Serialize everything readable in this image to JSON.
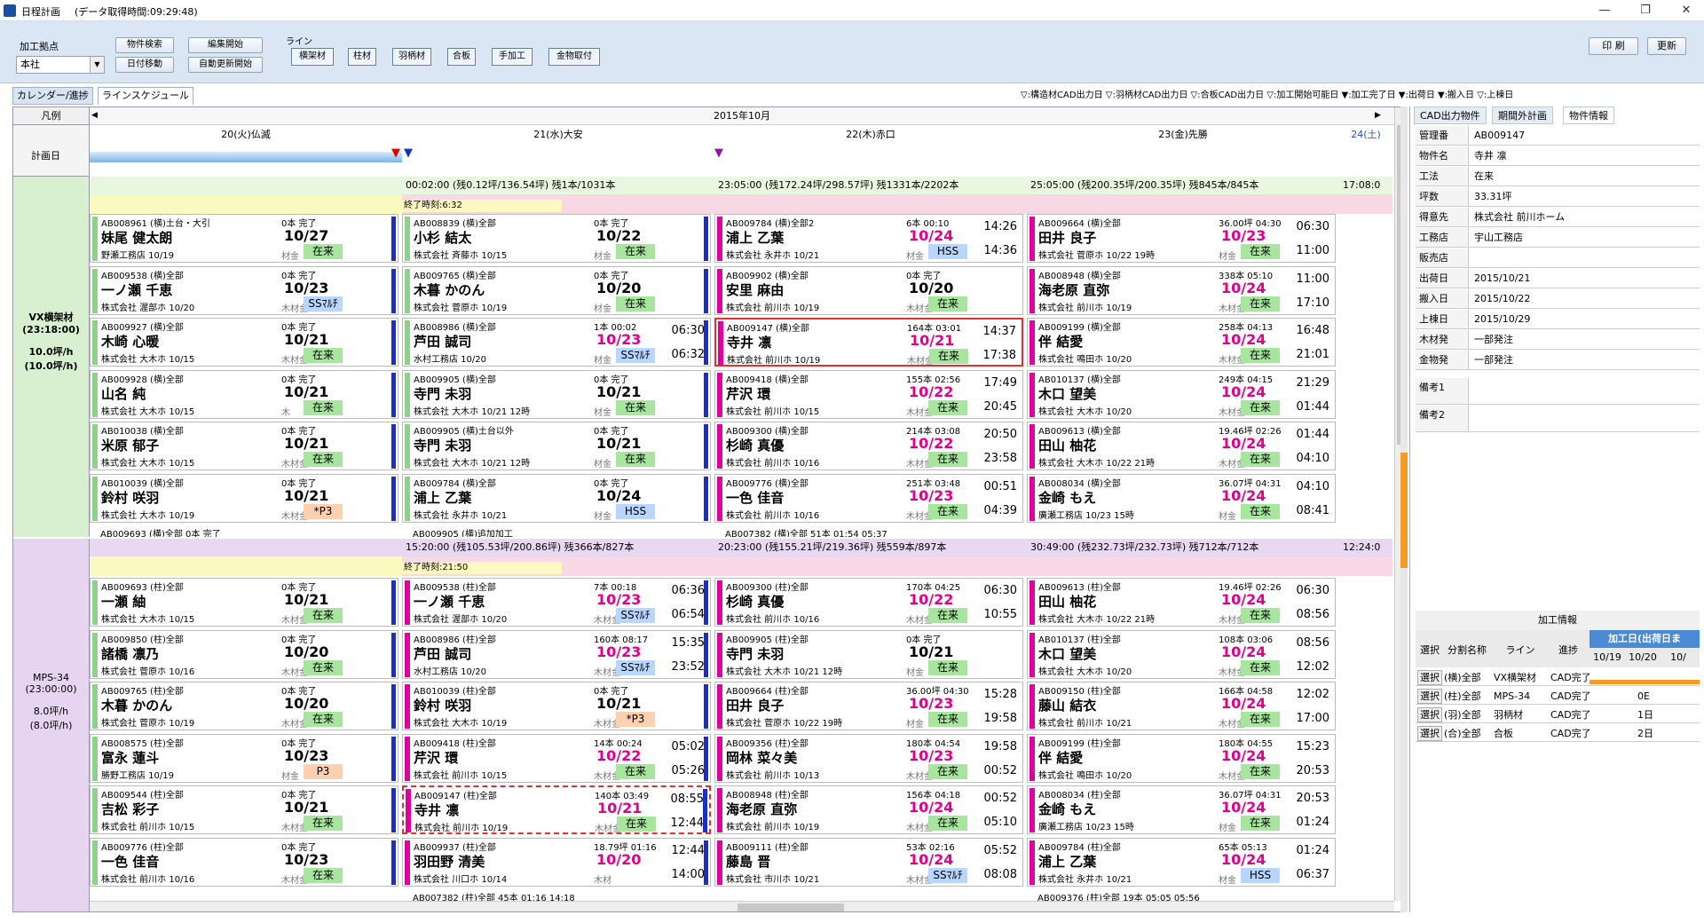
{
  "window": {
    "title": "日程計画",
    "subtitle": "(データ取得時間:09:29:48)",
    "minimize": "—",
    "maximize": "❐",
    "close": "✕"
  },
  "toolbar": {
    "site_label": "加工拠点",
    "site_value": "本社",
    "item_search": "物件検索",
    "edit_start": "編集開始",
    "date_move": "日付移動",
    "auto_update": "自動更新開始",
    "line_label": "ライン",
    "line_buttons": [
      "横架材",
      "柱材",
      "羽柄材",
      "合板",
      "手加工",
      "金物取付"
    ],
    "print": "印 刷",
    "refresh": "更新"
  },
  "tabs": [
    "カレンダー/進捗",
    "ラインスケジュール"
  ],
  "legend_text": "▽:構造材CAD出力日 ▽:羽柄材CAD出力日 ▽:合板CAD出力日 ▽:加工開始可能日 ▼:加工完了日 ▼:出荷日 ▼:搬入日 ▽:上棟日",
  "colors": {
    "accent_green": "#8fd08a",
    "magenta": "#e000a0",
    "blue": "#2030c0",
    "header_green": "#e8f7e0",
    "header_pink": "#f8d8e4",
    "header_purple": "#ead8f2"
  },
  "grid": {
    "legend_label": "凡例",
    "month": "2015年10月",
    "plan_label": "計画日",
    "days": [
      "20(火)仏滅",
      "21(水)大安",
      "22(木)赤口",
      "23(金)先勝",
      "24(土)"
    ]
  },
  "lines": [
    {
      "name": "VX横架材",
      "time": "(23:18:00)",
      "rate1": "10.0坪/h",
      "rate2": "(10.0坪/h)",
      "headers": [
        "",
        "00:02:00 (残0.12坪/136.54坪) 残1本/1031本",
        "23:05:00 (残172.24坪/298.57坪) 残1331本/2202本",
        "25:05:00 (残200.35坪/200.35坪) 残845本/845本",
        "17:08:0"
      ],
      "end_time": "終了時刻:6:32"
    },
    {
      "name": "MPS-34",
      "time": "(23:00:00)",
      "rate1": "8.0坪/h",
      "rate2": "(8.0坪/h)",
      "headers": [
        "",
        "15:20:00 (残105.53坪/200.86坪) 残366本/827本",
        "20:23:00 (残155.21坪/219.36坪) 残559本/897本",
        "30:49:00 (残232.73坪/232.73坪) 残712本/712本",
        "12:24:0"
      ],
      "end_time": "終了時刻:21:50"
    }
  ],
  "cards": [
    [
      [
        "AB008961 (横)土台・大引",
        "0本 完了",
        "妹尾 健太朗",
        "10/27",
        "野瀬工務店 10/19",
        "材金",
        "在来",
        "",
        ""
      ],
      [
        "AB009538 (横)全部",
        "0本 完了",
        "一ノ瀬 千恵",
        "10/23",
        "株式会社 渥部ホ 10/20",
        "木材金",
        "SSﾏﾙﾁ",
        "",
        ""
      ],
      [
        "AB009927 (横)全部",
        "0本 完了",
        "木崎 心暖",
        "10/21",
        "株式会社 大木ホ 10/15",
        "木材金",
        "在来",
        "",
        ""
      ],
      [
        "AB009928 (横)全部",
        "0本 完了",
        "山名 純",
        "10/21",
        "株式会社 大木ホ 10/15",
        "木",
        "在来",
        "",
        ""
      ],
      [
        "AB010038 (横)全部",
        "0本 完了",
        "米原 郁子",
        "10/21",
        "株式会社 大木ホ 10/15",
        "木材金",
        "在来",
        "",
        ""
      ],
      [
        "AB010039 (横)全部",
        "0本 完了",
        "鈴村 咲羽",
        "10/21",
        "株式会社 大木ホ 10/19",
        "木材金",
        "*P3",
        "",
        ""
      ]
    ],
    [
      [
        "AB008839 (横)全部",
        "0本 完了",
        "小杉 結太",
        "10/22",
        "株式会社 斉藤ホ 10/15",
        "材金",
        "在来",
        "",
        ""
      ],
      [
        "AB009765 (横)全部",
        "0本 完了",
        "木暮 かのん",
        "10/20",
        "株式会社 菅原ホ 10/19",
        "材金",
        "在来",
        "",
        ""
      ],
      [
        "AB008986 (横)全部",
        "1本 00:02",
        "芦田 誠司",
        "10/23",
        "水村工務店 10/20",
        "材金",
        "SSﾏﾙﾁ",
        "06:30",
        "06:32"
      ],
      [
        "AB009905 (横)全部",
        "0本 完了",
        "寺門 未羽",
        "10/21",
        "株式会社 大木ホ 10/21 12時",
        "材金",
        "在来",
        "",
        ""
      ],
      [
        "AB009905 (横)土台以外",
        "0本 完了",
        "寺門 未羽",
        "10/21",
        "株式会社 大木ホ 10/21 12時",
        "材金",
        "在来",
        "",
        ""
      ],
      [
        "AB009784 (横)全部",
        "0本 完了",
        "浦上 乙葉",
        "10/24",
        "株式会社 永井ホ 10/21",
        "材金",
        "HSS",
        "",
        ""
      ]
    ],
    [
      [
        "AB009784 (横)全部2",
        "6本 00:10",
        "浦上 乙葉",
        "10/24",
        "株式会社 永井ホ 10/21",
        "材金",
        "HSS",
        "14:26",
        "14:36"
      ],
      [
        "AB009902 (横)全部",
        "0本 完了",
        "安里 麻由",
        "10/20",
        "株式会社 前川ホ 10/19",
        "木材金",
        "在来",
        "",
        ""
      ],
      [
        "AB009147 (横)全部",
        "164本 03:01",
        "寺井 凛",
        "10/21",
        "株式会社 前川ホ 10/19",
        "木材金",
        "在来",
        "14:37",
        "17:38"
      ],
      [
        "AB009418 (横)全部",
        "155本 02:56",
        "芹沢 環",
        "10/22",
        "株式会社 前川ホ 10/15",
        "木材金",
        "在来",
        "17:49",
        "20:45"
      ],
      [
        "AB009300 (横)全部",
        "214本 03:08",
        "杉崎 真優",
        "10/22",
        "株式会社 前川ホ 10/16",
        "木材金",
        "在来",
        "20:50",
        "23:58"
      ],
      [
        "AB009776 (横)全部",
        "251本 03:48",
        "一色 佳音",
        "10/23",
        "株式会社 前川ホ 10/16",
        "木材金",
        "在来",
        "00:51",
        "04:39"
      ]
    ],
    [
      [
        "AB009664 (横)全部",
        "36.00坪 04:30",
        "田井 良子",
        "10/23",
        "株式会社 菅原ホ 10/22 19時",
        "材金",
        "在来",
        "06:30",
        "11:00"
      ],
      [
        "AB008948 (横)全部",
        "338本 05:10",
        "海老原 直弥",
        "10/24",
        "株式会社 前川ホ 10/19",
        "木材金",
        "在来",
        "11:00",
        "17:10"
      ],
      [
        "AB009199 (横)全部",
        "258本 04:13",
        "伴 結愛",
        "10/24",
        "株式会社 鳴田ホ 10/20",
        "木材金",
        "在来",
        "16:48",
        "21:01"
      ],
      [
        "AB010137 (横)全部",
        "249本 04:15",
        "木口 望美",
        "10/24",
        "株式会社 大木ホ 10/20",
        "木材金",
        "在来",
        "21:29",
        "01:44"
      ],
      [
        "AB009613 (横)全部",
        "19.46坪 02:26",
        "田山 柚花",
        "10/24",
        "株式会社 大木ホ 10/22 21時",
        "木材金",
        "在来",
        "01:44",
        "04:10"
      ],
      [
        "AB008034 (横)全部",
        "36.07坪 04:31",
        "金崎 もえ",
        "10/24",
        "廣瀬工務店 10/23 15時",
        "材金",
        "在来",
        "04:10",
        "08:41"
      ]
    ]
  ],
  "cards2": [
    [
      [
        "AB009693 (柱)全部",
        "0本 完了",
        "一瀬 紬",
        "10/21",
        "株式会社 大木ホ 10/15",
        "木材金",
        "在来",
        "",
        ""
      ],
      [
        "AB009850 (柱)全部",
        "0本 完了",
        "諸橋 凛乃",
        "10/20",
        "株式会社 菅原ホ 10/16",
        "木材金",
        "在来",
        "",
        ""
      ],
      [
        "AB009765 (柱)全部",
        "0本 完了",
        "木暮 かのん",
        "10/20",
        "株式会社 菅原ホ 10/19",
        "木材金",
        "在来",
        "",
        ""
      ],
      [
        "AB008575 (柱)全部",
        "0本 完了",
        "富永 蓮斗",
        "10/23",
        "勝野工務店 10/19",
        "材金",
        "P3",
        "",
        ""
      ],
      [
        "AB009544 (柱)全部",
        "0本 完了",
        "吉松 彩子",
        "10/21",
        "株式会社 前川ホ 10/15",
        "木材金",
        "在来",
        "",
        ""
      ],
      [
        "AB009776 (柱)全部",
        "0本 完了",
        "一色 佳音",
        "10/23",
        "株式会社 前川ホ 10/16",
        "木材金",
        "在来",
        "",
        ""
      ]
    ],
    [
      [
        "AB009538 (柱)全部",
        "7本 00:18",
        "一ノ瀬 千恵",
        "10/23",
        "株式会社 渥部ホ 10/20",
        "木材金",
        "SSﾏﾙﾁ",
        "06:36",
        "06:54"
      ],
      [
        "AB008986 (柱)全部",
        "160本 08:17",
        "芦田 誠司",
        "10/23",
        "水村工務店 10/20",
        "木材金",
        "SSﾏﾙﾁ",
        "15:35",
        "23:52"
      ],
      [
        "AB010039 (柱)全部",
        "0本 完了",
        "鈴村 咲羽",
        "10/21",
        "株式会社 大木ホ 10/19",
        "木材金",
        "*P3",
        "",
        ""
      ],
      [
        "AB009418 (柱)全部",
        "14本 00:24",
        "芹沢 環",
        "10/22",
        "株式会社 前川ホ 10/15",
        "木材金",
        "在来",
        "05:02",
        "05:26"
      ],
      [
        "AB009147 (柱)全部",
        "140本 03:49",
        "寺井 凛",
        "10/21",
        "株式会社 前川ホ 10/19",
        "木材金",
        "在来",
        "08:55",
        "12:44"
      ],
      [
        "AB009937 (柱)全部",
        "18.79坪 01:16",
        "羽田野 清美",
        "10/20",
        "株式会社 川口ホ 10/14",
        "木材",
        "",
        "12:44",
        "14:00"
      ]
    ],
    [
      [
        "AB009300 (柱)全部",
        "170本 04:25",
        "杉崎 真優",
        "10/22",
        "株式会社 前川ホ 10/16",
        "木材金",
        "在来",
        "06:30",
        "10:55"
      ],
      [
        "AB009905 (柱)全部",
        "0本 完了",
        "寺門 未羽",
        "10/21",
        "株式会社 大木ホ 10/21 12時",
        "材金",
        "在来",
        "",
        ""
      ],
      [
        "AB009664 (柱)全部",
        "36.00坪 04:30",
        "田井 良子",
        "10/23",
        "株式会社 菅原ホ 10/22 19時",
        "材金",
        "在来",
        "15:28",
        "19:58"
      ],
      [
        "AB009356 (柱)全部",
        "180本 04:54",
        "岡林 菜々美",
        "10/23",
        "株式会社 前川ホ 10/13",
        "木材金",
        "在来",
        "19:58",
        "00:52"
      ],
      [
        "AB008948 (柱)全部",
        "156本 04:18",
        "海老原 直弥",
        "10/24",
        "株式会社 前川ホ 10/19",
        "木材金",
        "在来",
        "00:52",
        "05:10"
      ],
      [
        "AB009111 (柱)全部",
        "53本 02:16",
        "藤島 晋",
        "10/24",
        "株式会社 市川ホ 10/21",
        "木材金",
        "SSﾏﾙﾁ",
        "05:52",
        "08:08"
      ]
    ],
    [
      [
        "AB009613 (柱)全部",
        "19.46坪 02:26",
        "田山 柚花",
        "10/24",
        "株式会社 大木ホ 10/22 21時",
        "木材金",
        "在来",
        "06:30",
        "08:56"
      ],
      [
        "AB010137 (柱)全部",
        "108本 03:06",
        "木口 望美",
        "10/24",
        "株式会社 大木ホ 10/20",
        "木材金",
        "在来",
        "08:56",
        "12:02"
      ],
      [
        "AB009150 (柱)全部",
        "166本 04:58",
        "藤山 結衣",
        "10/24",
        "株式会社 前川ホ 10/21",
        "木材金",
        "在来",
        "12:02",
        "17:00"
      ],
      [
        "AB009199 (柱)全部",
        "180本 04:55",
        "伴 結愛",
        "10/24",
        "株式会社 鳴田ホ 10/20",
        "木材金",
        "在来",
        "15:23",
        "20:53"
      ],
      [
        "AB008034 (柱)全部",
        "36.07坪 04:31",
        "金崎 もえ",
        "10/24",
        "廣瀬工務店 10/23 15時",
        "材金",
        "在来",
        "20:53",
        "01:24"
      ],
      [
        "AB009784 (柱)全部",
        "65本 05:13",
        "浦上 乙葉",
        "10/24",
        "株式会社 永井ホ 10/21",
        "材金",
        "HSS",
        "01:24",
        "06:37"
      ]
    ]
  ],
  "partial_cards": {
    "col1_top": "AB009693 (横)全部 0本 完了",
    "col2_top": "AB009905 (横)追加加工",
    "col3_top": "AB007382 (横)全部 51本 01:54 05:37",
    "col2_bottom": "AB007382 (柱)全部 45本 01:16 14:18",
    "col4_bottom": "AB009376 (柱)全部 19本 05:05 05:56"
  },
  "right_panel": {
    "tabs": [
      "CAD出力物件",
      "期間外計画",
      "物件情報"
    ],
    "info": [
      {
        "k": "管理番",
        "v": "AB009147"
      },
      {
        "k": "物件名",
        "v": "寺井 凛"
      },
      {
        "k": "工法",
        "v": "在来"
      },
      {
        "k": "坪数",
        "v": "33.31坪"
      },
      {
        "k": "得意先",
        "v": "株式会社 前川ホーム"
      },
      {
        "k": "工務店",
        "v": "宇山工務店"
      },
      {
        "k": "販売店",
        "v": ""
      },
      {
        "k": "出荷日",
        "v": "2015/10/21"
      },
      {
        "k": "搬入日",
        "v": "2015/10/22"
      },
      {
        "k": "上棟日",
        "v": "2015/10/29"
      },
      {
        "k": "木材発",
        "v": "一部発注"
      },
      {
        "k": "金物発",
        "v": "一部発注"
      },
      {
        "k": "備考1",
        "v": ""
      },
      {
        "k": "備考2",
        "v": ""
      }
    ],
    "proc_title": "加工情報",
    "proc_headers": [
      "選択",
      "分割名称",
      "ライン",
      "進捗",
      "加工日(出荷日ま"
    ],
    "proc_dates": [
      "10/19",
      "10/20",
      "10/"
    ],
    "proc_rows": [
      [
        "選択",
        "(横)全部",
        "VX横架材",
        "CAD完了",
        ""
      ],
      [
        "選択",
        "(柱)全部",
        "MPS-34",
        "CAD完了",
        "0E"
      ],
      [
        "選択",
        "(羽)全部",
        "羽柄材",
        "CAD完了",
        "1日"
      ],
      [
        "選択",
        "(合)全部",
        "合板",
        "CAD完了",
        "2日"
      ]
    ]
  }
}
